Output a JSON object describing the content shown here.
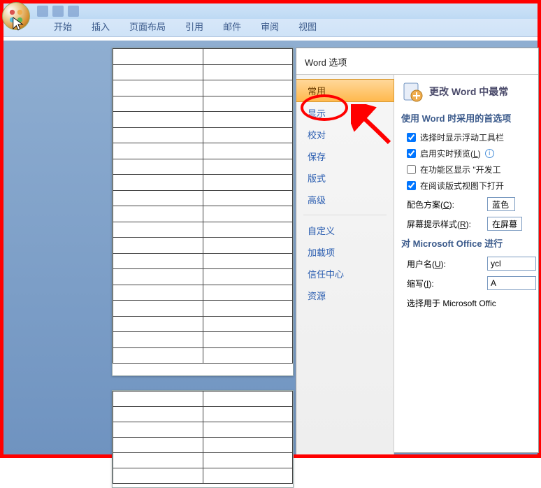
{
  "ribbon": {
    "tabs": [
      "开始",
      "插入",
      "页面布局",
      "引用",
      "邮件",
      "审阅",
      "视图"
    ]
  },
  "dialog": {
    "title": "Word 选项",
    "sidebar": [
      {
        "label": "常用",
        "selected": true
      },
      {
        "label": "显示"
      },
      {
        "label": "校对"
      },
      {
        "label": "保存"
      },
      {
        "label": "版式"
      },
      {
        "label": "高级"
      },
      {
        "sep": true
      },
      {
        "label": "自定义"
      },
      {
        "label": "加载项"
      },
      {
        "label": "信任中心"
      },
      {
        "label": "资源"
      }
    ],
    "content": {
      "header": "更改 Word 中最常",
      "section1_title": "使用 Word 时采用的首选项",
      "opt1": "选择时显示浮动工具栏",
      "opt2": "启用实时预览(L)",
      "opt3": "在功能区显示 \"开发工",
      "opt4": "在阅读版式视图下打开",
      "color_label": "配色方案(C):",
      "color_value": "蓝色",
      "tip_label": "屏幕提示样式(R):",
      "tip_value": "在屏幕",
      "section2_title": "对 Microsoft Office 进行",
      "user_label": "用户名(U):",
      "user_value": "ycl",
      "abbr_label": "缩写(I):",
      "abbr_value": "A",
      "note": "选择用于 Microsoft Offic"
    }
  }
}
